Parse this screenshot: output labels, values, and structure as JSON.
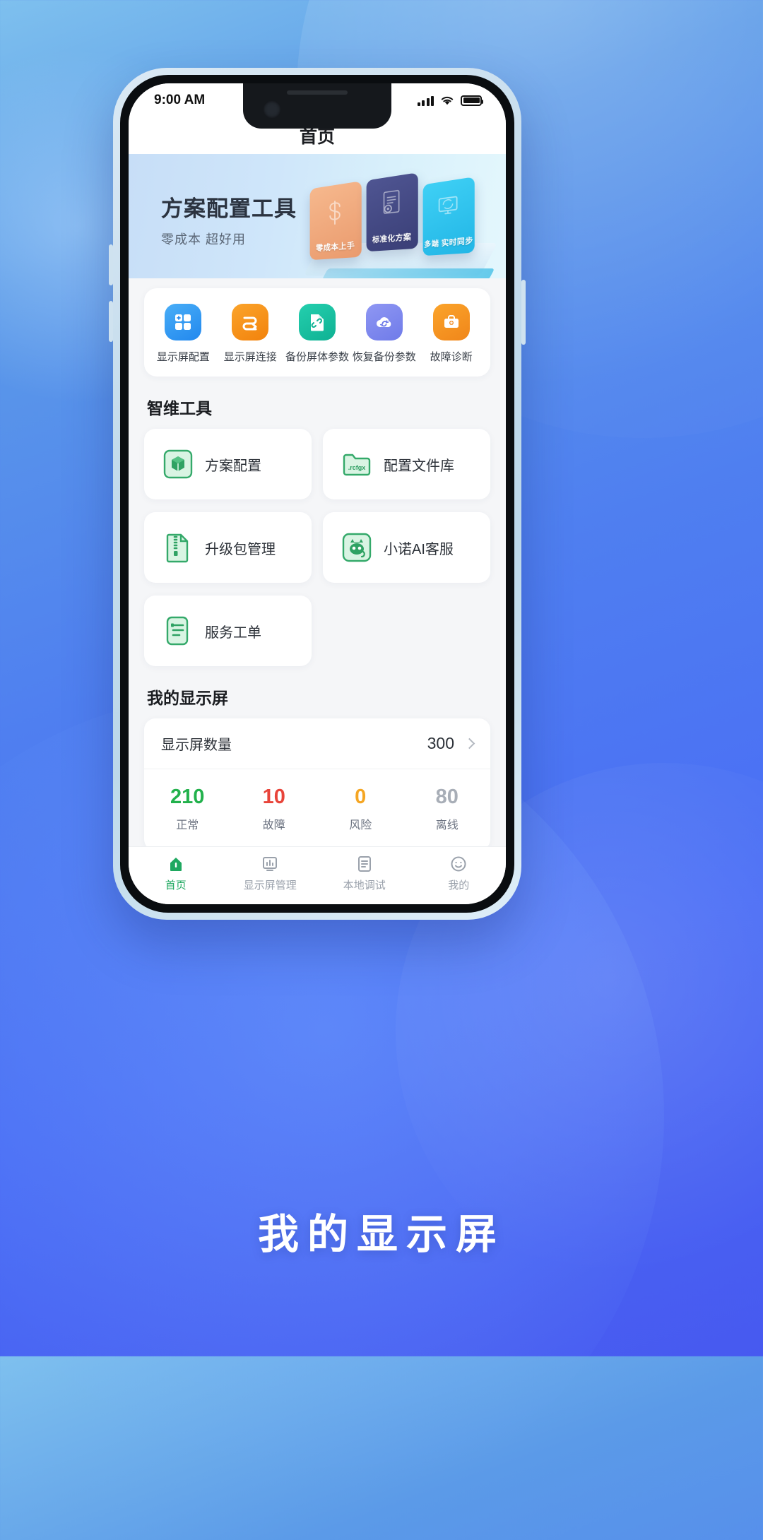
{
  "status_bar": {
    "time": "9:00 AM",
    "signal_icon": "cellular-signal-icon",
    "wifi_icon": "wifi-icon",
    "battery_icon": "battery-icon"
  },
  "header": {
    "title": "首页"
  },
  "banner": {
    "title": "方案配置工具",
    "subtitle": "零成本 超好用",
    "cards": [
      {
        "caption": "零成本上手",
        "color": "#ea9b6e",
        "glyph": "dollar-sign-icon"
      },
      {
        "caption": "标准化方案",
        "color": "#3a3f77",
        "glyph": "document-gear-icon"
      },
      {
        "caption": "多端\n实时同步",
        "color": "#22b6e6",
        "glyph": "monitor-sync-icon"
      }
    ]
  },
  "quick_actions": [
    {
      "label": "显示屏配置",
      "icon": "grid-squares-icon",
      "color": "#2f9bf2"
    },
    {
      "label": "显示屏连接",
      "icon": "link-arrows-icon",
      "color": "#f7921e"
    },
    {
      "label": "备份屏体参数",
      "icon": "file-link-icon",
      "color": "#15bfa0"
    },
    {
      "label": "恢复备份参数",
      "icon": "cloud-restore-icon",
      "color": "#7b86ee"
    },
    {
      "label": "故障诊断",
      "icon": "toolbox-icon",
      "color": "#f5922a"
    }
  ],
  "tools_section": {
    "title": "智维工具",
    "items": [
      {
        "label": "方案配置",
        "icon": "cube-box-icon"
      },
      {
        "label": "配置文件库",
        "icon": "rcfgx-folder-icon",
        "badge": ".rcfgx"
      },
      {
        "label": "升级包管理",
        "icon": "zip-file-icon"
      },
      {
        "label": "小诺AI客服",
        "icon": "ai-mascot-icon"
      },
      {
        "label": "服务工单",
        "icon": "work-order-icon"
      }
    ]
  },
  "my_screens": {
    "title": "我的显示屏",
    "count_label": "显示屏数量",
    "count_value": "300",
    "chevron_icon": "chevron-right-icon",
    "stats": [
      {
        "value": "210",
        "label": "正常",
        "color": "#22b14c"
      },
      {
        "value": "10",
        "label": "故障",
        "color": "#e8443a"
      },
      {
        "value": "0",
        "label": "风险",
        "color": "#f5a623"
      },
      {
        "value": "80",
        "label": "离线",
        "color": "#a8aeb7"
      }
    ]
  },
  "tabbar": [
    {
      "label": "首页",
      "icon": "home-icon",
      "active": true
    },
    {
      "label": "显示屏管理",
      "icon": "screen-manage-icon",
      "active": false
    },
    {
      "label": "本地调试",
      "icon": "local-debug-icon",
      "active": false
    },
    {
      "label": "我的",
      "icon": "profile-smiley-icon",
      "active": false
    }
  ],
  "caption": "我的显示屏"
}
